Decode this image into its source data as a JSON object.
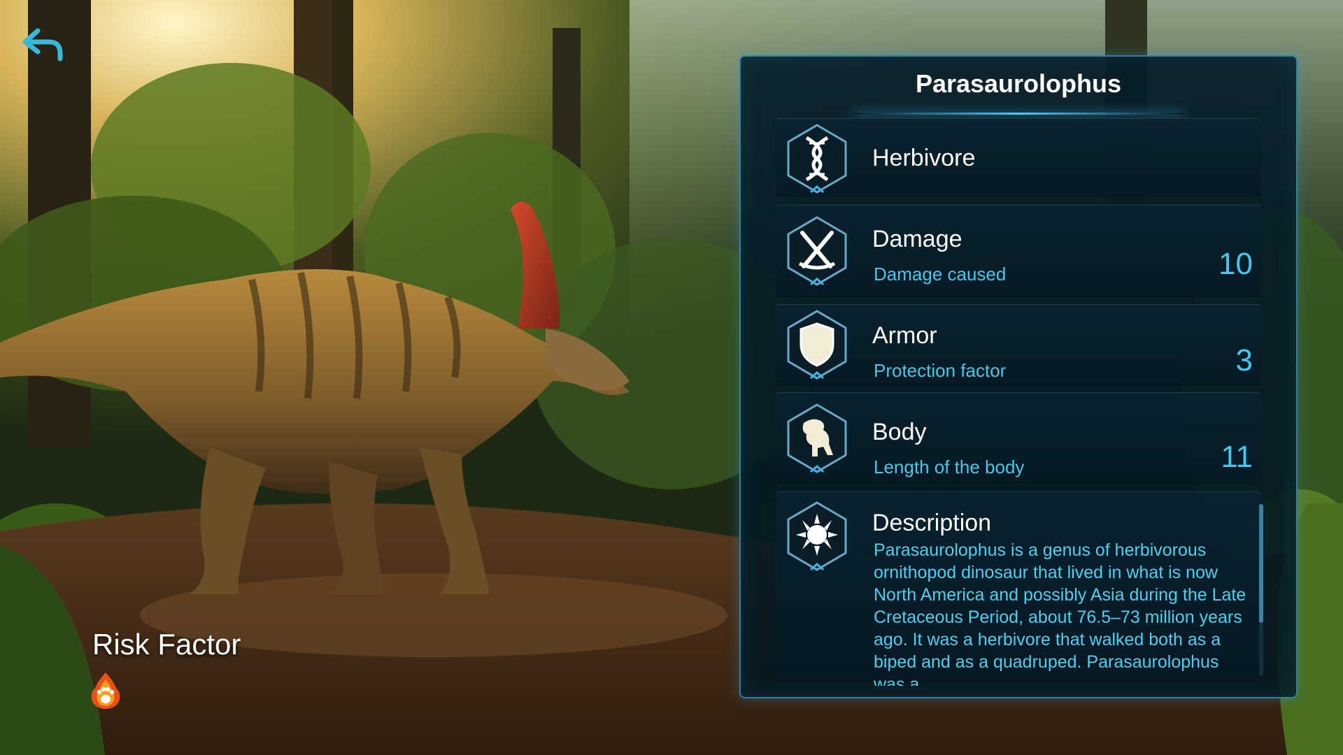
{
  "header": {
    "back_icon": "back-arrow-icon"
  },
  "risk": {
    "title": "Risk Factor",
    "icon": "paw-fire-icon"
  },
  "panel": {
    "title": "Parasaurolophus",
    "diet": {
      "label": "Herbivore",
      "icon": "dna-icon"
    },
    "stats": [
      {
        "label": "Damage",
        "sub": "Damage caused",
        "value": "10",
        "icon": "crossed-swords-icon"
      },
      {
        "label": "Armor",
        "sub": "Protection factor",
        "value": "3",
        "icon": "shield-icon"
      },
      {
        "label": "Body",
        "sub": "Length of the body",
        "value": "11",
        "icon": "dinosaur-icon"
      }
    ],
    "description": {
      "label": "Description",
      "icon": "sun-emblem-icon",
      "text": "Parasaurolophus is a genus of herbivorous ornithopod dinosaur that lived in what is now North America and possibly Asia during the Late Cretaceous Period, about 76.5–73 million years ago. It was a herbivore that walked both as a biped and as a quadruped. Parasaurolophus was a"
    }
  },
  "colors": {
    "accent": "#44c8f0",
    "panel_border": "#46aad2",
    "text_primary": "#ffffff"
  }
}
